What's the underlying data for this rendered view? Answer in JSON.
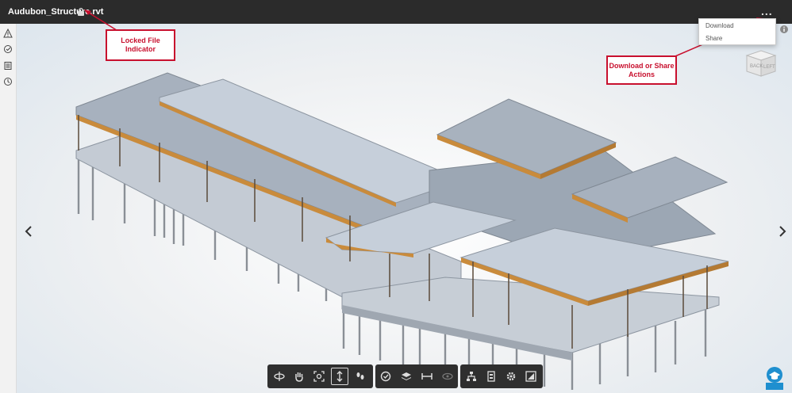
{
  "header": {
    "file_name": "Audubon_Structure.rvt",
    "more_label": "..."
  },
  "menu": {
    "items": [
      {
        "label": "Download",
        "icon": "download-icon"
      },
      {
        "label": "Share",
        "icon": "share-icon"
      }
    ]
  },
  "callouts": {
    "locked": "Locked File Indicator",
    "actions": "Download or Share Actions"
  },
  "viewcube": {
    "back": "BACK",
    "left": "LEFT"
  },
  "sidebar": {
    "icons": [
      "warning-icon",
      "issues-icon",
      "sheets-icon",
      "history-icon"
    ]
  },
  "toolbar": {
    "groups": [
      [
        "orbit-icon",
        "pan-icon",
        "fit-view-icon",
        "zoom-icon",
        "first-person-icon"
      ],
      [
        "measure-icon",
        "section-icon",
        "explode-icon",
        "visibility-icon"
      ],
      [
        "model-browser-icon",
        "properties-icon",
        "settings-icon",
        "fullscreen-icon"
      ]
    ]
  },
  "colors": {
    "callout": "#c8102e",
    "topbar": "#2b2b2b",
    "toolbar": "#2f2f2f",
    "floor": "#a9b4c2",
    "timber": "#c98b3c"
  }
}
